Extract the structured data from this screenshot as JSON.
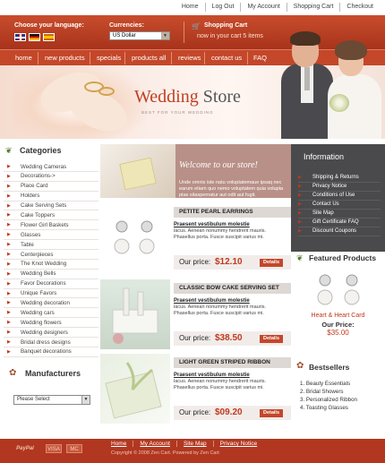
{
  "top_links": [
    "Home",
    "Log Out",
    "My Account",
    "Shopping Cart",
    "Checkout"
  ],
  "header": {
    "language_label": "Choose your language:",
    "currencies_label": "Currencies:",
    "currency_selected": "US Dollar",
    "cart_title": "Shopping Cart",
    "cart_status": "now in your cart 5 items"
  },
  "nav": [
    "home",
    "new products",
    "specials",
    "products all",
    "reviews",
    "contact us",
    "FAQ"
  ],
  "banner": {
    "brand_main": "Wedding",
    "brand_rest": " Store",
    "tagline": "BEST FOR YOUR WEDDING"
  },
  "categories": {
    "title": "Categories",
    "items": [
      "Wedding Cameras",
      "Decorations->",
      "Place Card",
      "Holders",
      "Cake Serving Sets",
      "Cake Toppers",
      "Flower Girl Baskets",
      "Glasses",
      "Table",
      "Centerpieces",
      "The Knot Wedding",
      "Wedding Bells",
      "Favor Decorations",
      "Unique Favors",
      "Wedding decoration",
      "Wedding cars",
      "Wedding flowers",
      "Wedding designers",
      "Bridal dress designs",
      "Banquet decorations"
    ]
  },
  "manufacturers": {
    "title": "Manufacturers",
    "select_value": "Please Select"
  },
  "welcome": {
    "title": "Welcome to our store!",
    "text": "Unde omnis iste natu voluptatemaue ipsaq nec earum etiam quo nemo voluptatem quia volupta ptas sitaspernatur aut odit aut fugit."
  },
  "products": [
    {
      "title": "PETITE PEARL EARRINGS",
      "subtitle": "Praesent vestibulum molestie",
      "desc": "lacus. Aenean nonummy hendrerit mauris. Phasellus porta. Fusce suscipit varius mi.",
      "price_label": "Our price:",
      "price": "$12.10",
      "details": "Details"
    },
    {
      "title": "CLASSIC BOW CAKE SERVING SET",
      "subtitle": "Praesent vestibulum molestie",
      "desc": "lacus. Aenean nonummy hendrerit mauris. Phasellus porta. Fusce suscipit varius mi.",
      "price_label": "Our price:",
      "price": "$38.50",
      "details": "Details"
    },
    {
      "title": "LIGHT GREEN STRIPED RIBBON",
      "subtitle": "Praesent vestibulum molestie",
      "desc": "lacus. Aenean nonummy hendrerit mauris. Phasellus porta. Fusce suscipit varius mi.",
      "price_label": "Our price:",
      "price": "$09.20",
      "details": "Details"
    }
  ],
  "information": {
    "title": "Information",
    "items": [
      "Shipping & Returns",
      "Privacy Notice",
      "Conditions of Use",
      "Contact Us",
      "Site Map",
      "Gift Certificate FAQ",
      "Discount Coupons"
    ]
  },
  "featured": {
    "title": "Featured Products",
    "name": "Heart & Heart Card",
    "price_label": "Our Price:",
    "price": "$35.00"
  },
  "bestsellers": {
    "title": "Bestsellers",
    "items": [
      "1. Beauty Essentials",
      "2. Bridal Showers",
      "3. Personalized Ribbon",
      "4. Toasting Glasses"
    ]
  },
  "footer": {
    "payments": [
      "PayPal",
      "VISA",
      "MC"
    ],
    "links": [
      "Home",
      "My Account",
      "Site Map",
      "Privacy Notice"
    ],
    "copyright": "Copyright © 2008 Zen Cart. Powered by Zen Cart"
  },
  "colors": {
    "brand_red": "#c4472a",
    "info_bg": "#4a4a4c",
    "price_red": "#c0391d"
  },
  "icons": {
    "cart": "cart-icon",
    "categories": "leaf-icon",
    "manufacturers": "tag-icon",
    "featured": "leaf-icon",
    "bestsellers": "tag-icon"
  }
}
